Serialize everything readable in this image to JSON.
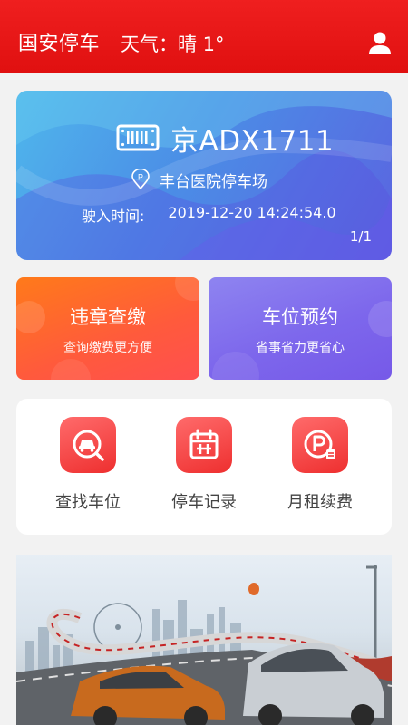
{
  "header": {
    "title": "国安停车",
    "weather": "天气：晴 1°",
    "user_icon": "user-icon"
  },
  "parking": {
    "plate": "京ADX1711",
    "lot": "丰台医院停车场",
    "entry_label": "驶入时间:",
    "entry_time": "2019-12-20 14:24:54.0",
    "pager": "1/1"
  },
  "tiles": [
    {
      "title": "违章查缴",
      "subtitle": "查询缴费更方便"
    },
    {
      "title": "车位预约",
      "subtitle": "省事省力更省心"
    }
  ],
  "actions": [
    {
      "label": "查找车位",
      "icon": "find-parking-icon"
    },
    {
      "label": "停车记录",
      "icon": "calendar-record-icon"
    },
    {
      "label": "月租续费",
      "icon": "parking-fee-icon"
    }
  ],
  "colors": {
    "header_red": "#e01010",
    "card_blue": "#4b8de6",
    "tile_orange": "#ff6a2a",
    "tile_purple": "#7d67ec",
    "action_red": "#ee2f2f"
  }
}
